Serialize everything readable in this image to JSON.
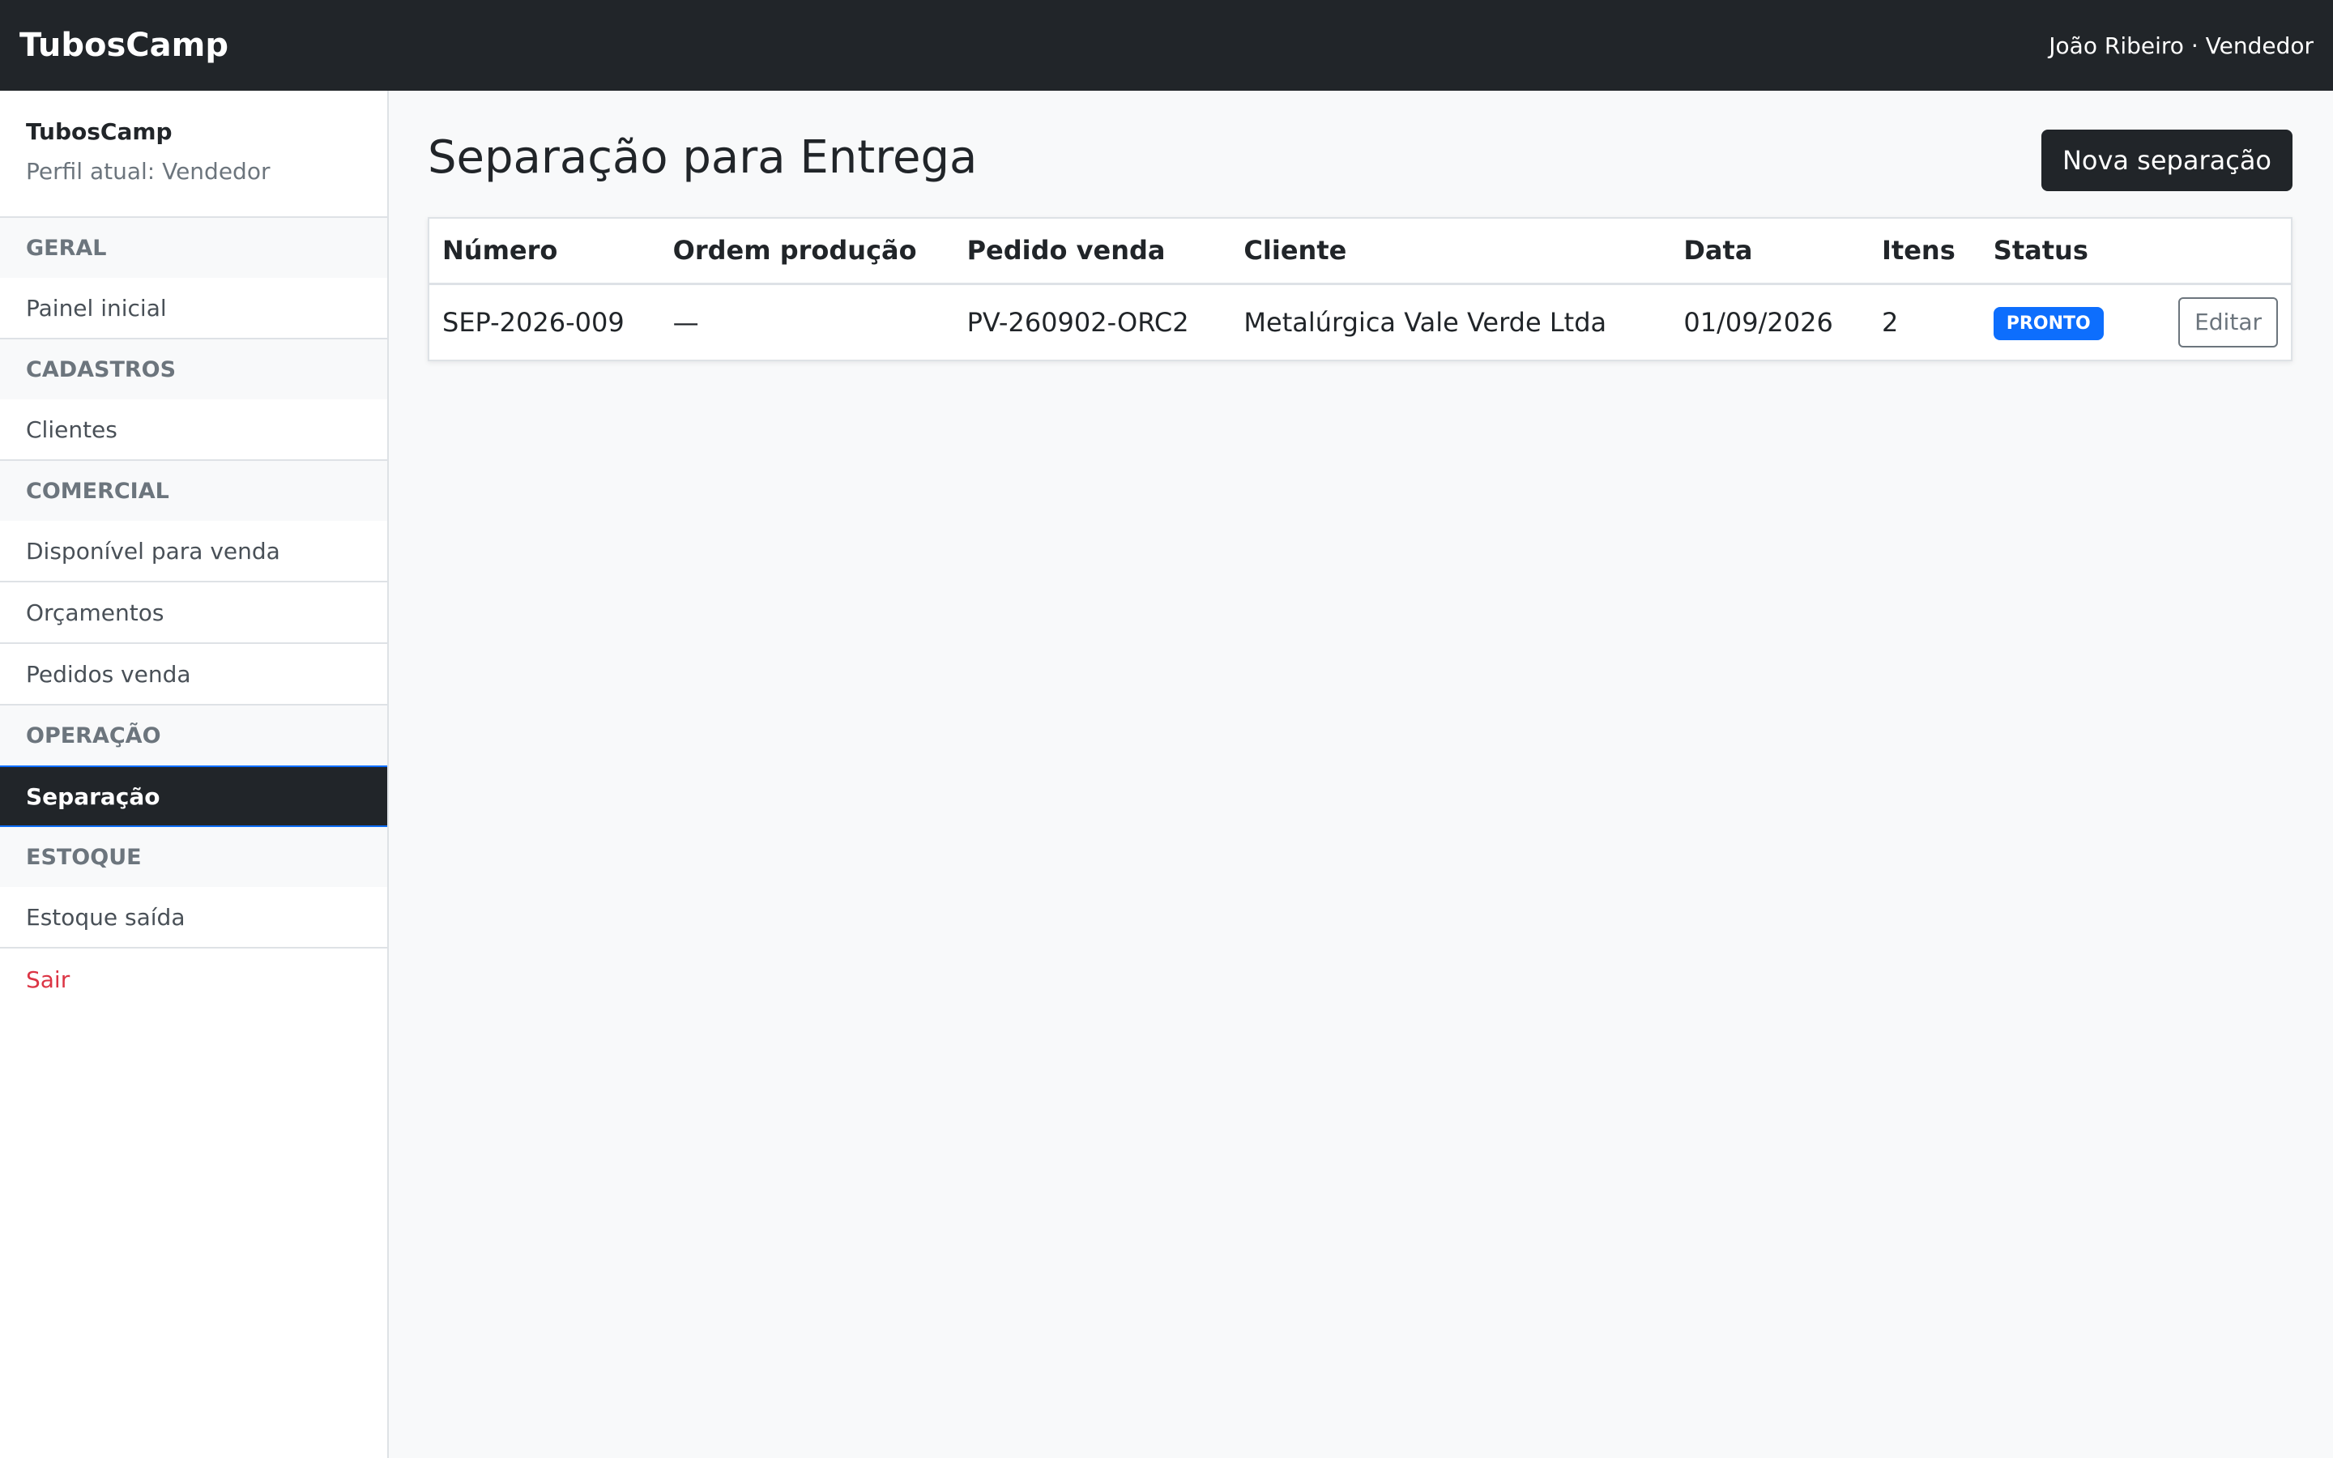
{
  "topbar": {
    "brand": "TubosCamp",
    "user": "João Ribeiro · Vendedor"
  },
  "sidebar": {
    "app_name": "TubosCamp",
    "role": "Perfil atual: Vendedor",
    "groups": [
      {
        "label": "GERAL",
        "items": [
          {
            "label": "Painel inicial"
          }
        ]
      },
      {
        "label": "CADASTROS",
        "items": [
          {
            "label": "Clientes"
          }
        ]
      },
      {
        "label": "COMERCIAL",
        "items": [
          {
            "label": "Disponível para venda"
          },
          {
            "label": "Orçamentos"
          },
          {
            "label": "Pedidos venda"
          }
        ]
      },
      {
        "label": "OPERAÇÃO",
        "items": [
          {
            "label": "Separação",
            "active": true
          }
        ]
      },
      {
        "label": "ESTOQUE",
        "items": [
          {
            "label": "Estoque saída"
          }
        ]
      }
    ],
    "logout": "Sair"
  },
  "main": {
    "title": "Separação para Entrega",
    "new_button": "Nova separação",
    "table": {
      "columns": [
        "Número",
        "Ordem produção",
        "Pedido venda",
        "Cliente",
        "Data",
        "Itens",
        "Status"
      ],
      "rows": [
        {
          "numero": "SEP-2026-009",
          "ordem": "—",
          "pedido": "PV-260902-ORC2",
          "cliente": "Metalúrgica Vale Verde Ltda",
          "data": "01/09/2026",
          "itens": "2",
          "status": "PRONTO",
          "action": "Editar"
        }
      ]
    }
  },
  "colors": {
    "dark": "#212529",
    "accent": "#0d6efd",
    "danger": "#dc3545",
    "muted": "#6c757d"
  }
}
